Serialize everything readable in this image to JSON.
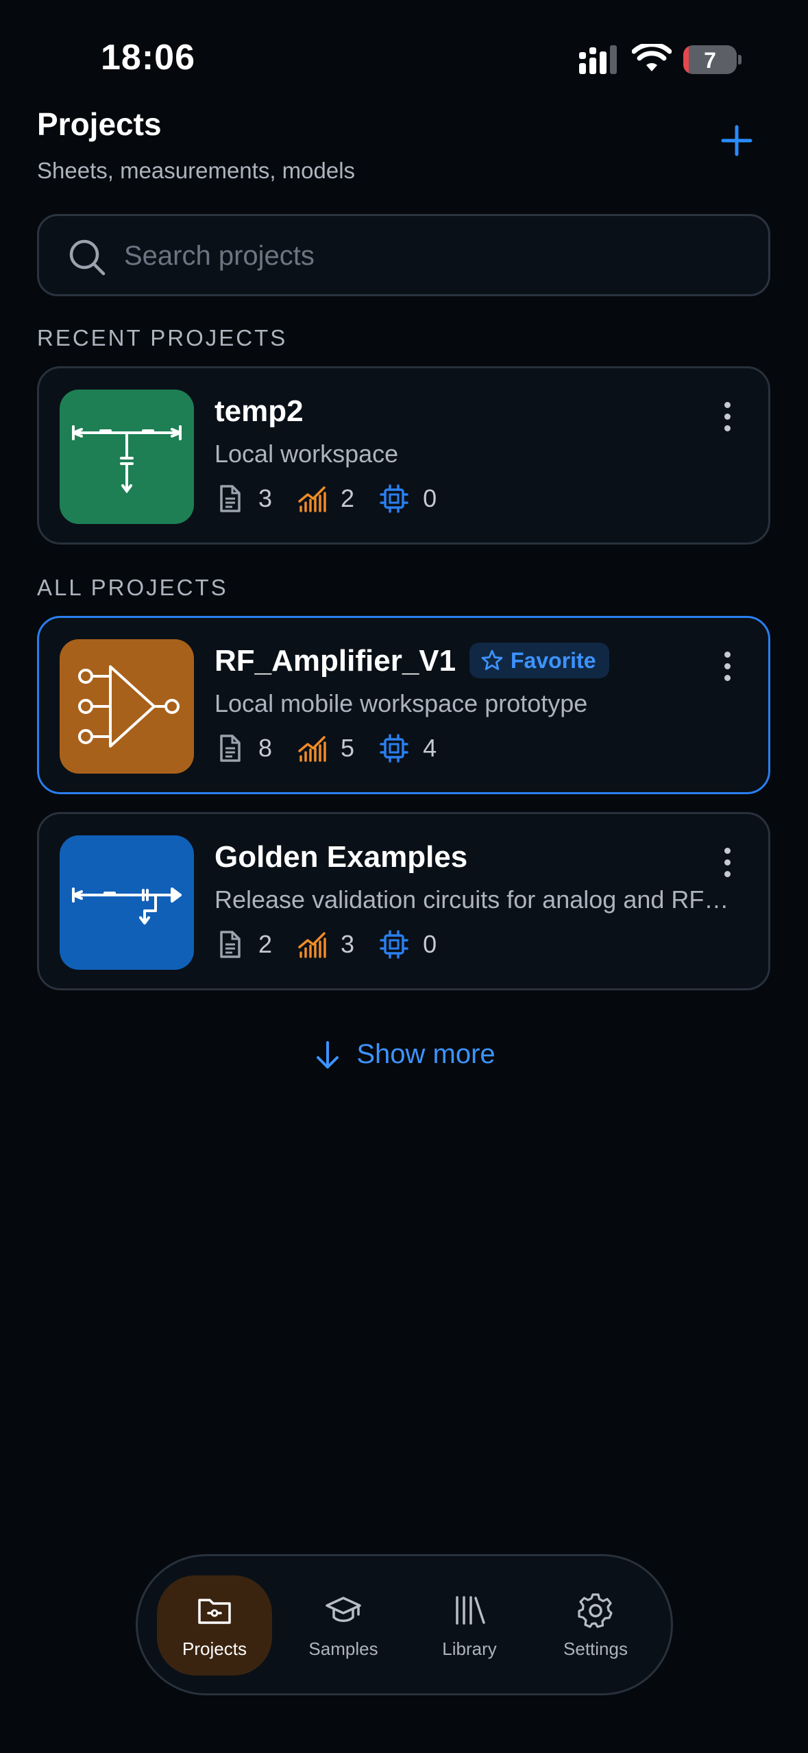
{
  "status_bar": {
    "time": "18:06",
    "battery": "7"
  },
  "header": {
    "title": "Projects",
    "subtitle": "Sheets, measurements, models"
  },
  "search": {
    "placeholder": "Search projects"
  },
  "sections": {
    "recent": "RECENT PROJECTS",
    "all": "ALL PROJECTS"
  },
  "recent_projects": [
    {
      "name": "temp2",
      "description": "Local workspace",
      "sheets": "3",
      "measurements": "2",
      "models": "0",
      "thumb_color": "#1e7f55"
    }
  ],
  "all_projects": [
    {
      "name": "RF_Amplifier_V1",
      "badge": "Favorite",
      "description": "Local mobile workspace prototype",
      "sheets": "8",
      "measurements": "5",
      "models": "4",
      "thumb_color": "#a8611b"
    },
    {
      "name": "Golden Examples",
      "description": "Release validation circuits for analog and RF…",
      "sheets": "2",
      "measurements": "3",
      "models": "0",
      "thumb_color": "#1060b8"
    }
  ],
  "show_more": "Show more",
  "tabs": [
    {
      "label": "Projects",
      "icon": "folder-icon",
      "active": true
    },
    {
      "label": "Samples",
      "icon": "graduation-cap-icon"
    },
    {
      "label": "Library",
      "icon": "library-icon"
    },
    {
      "label": "Settings",
      "icon": "gear-icon"
    }
  ],
  "colors": {
    "accent": "#3d93ff",
    "measurement": "#f08c28",
    "model": "#2a7ff0",
    "background": "#05080c"
  }
}
